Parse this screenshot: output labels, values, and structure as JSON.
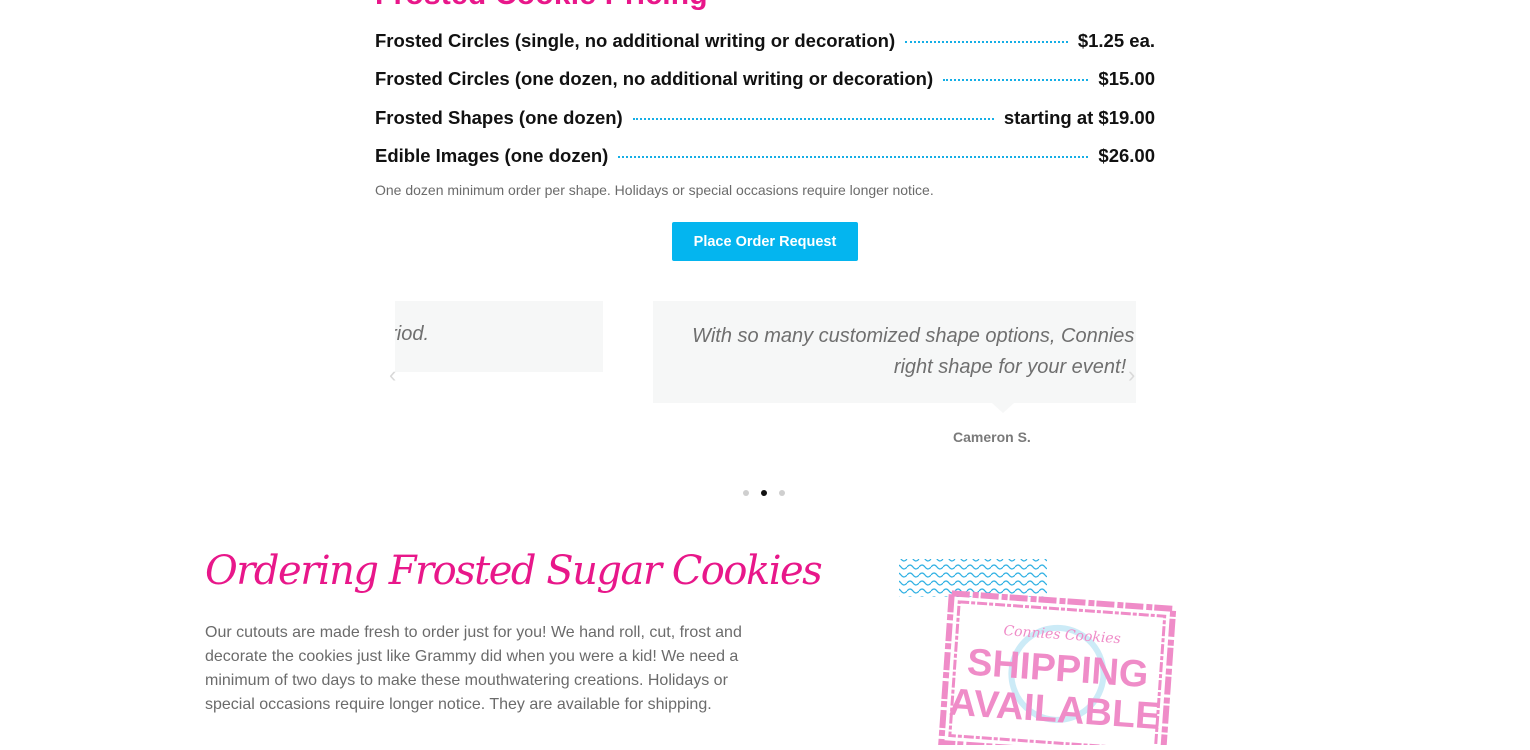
{
  "pricing": {
    "title": "Frosted Cookie Pricing",
    "items": [
      {
        "name": "Frosted Circles (single, no additional writing or decoration)",
        "price": "$1.25 ea."
      },
      {
        "name": "Frosted Circles (one dozen, no additional writing or decoration)",
        "price": "$15.00"
      },
      {
        "name": "Frosted Shapes (one dozen)",
        "price": "starting at $19.00"
      },
      {
        "name": "Edible Images (one dozen)",
        "price": "$26.00"
      }
    ],
    "note": "One dozen minimum order per shape. Holidays or special occasions require longer notice.",
    "button_label": "Place Order Request"
  },
  "testimonials": {
    "prev_text": "riod.",
    "current_text": "With so many customized shape options, Connies Cookies will have the right shape for your event!",
    "current_author": "Cameron S.",
    "prev_arrow_icon": "chevron-left-icon",
    "next_arrow_icon": "chevron-right-icon",
    "slide_count": 3,
    "active_index": 1
  },
  "ordering": {
    "title": "Ordering Frosted Sugar Cookies",
    "body": "Our cutouts are made fresh to order just for you! We hand roll, cut, frost and decorate the cookies just like Grammy did when you were a kid! We need a minimum of two days to make these mouthwatering creations. Holidays or special occasions require longer notice. They are available for shipping."
  },
  "stamp": {
    "brand": "Connies Cookies",
    "line1": "SHIPPING",
    "line2": "AVAILABLE"
  },
  "colors": {
    "accent_pink": "#e8178a",
    "accent_blue": "#04b5ef",
    "leader_blue": "#15aee6",
    "stamp_pink": "#ef8cc8"
  }
}
